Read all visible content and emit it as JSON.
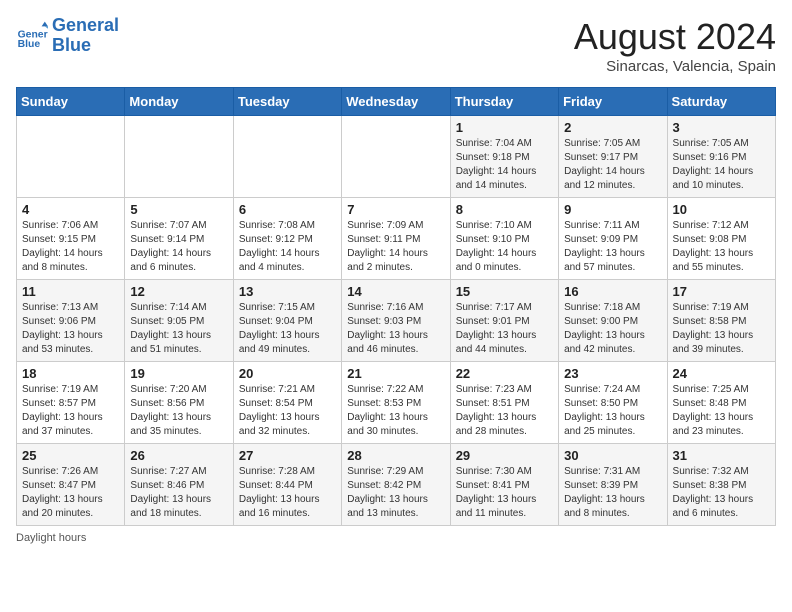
{
  "logo": {
    "line1": "General",
    "line2": "Blue"
  },
  "title": "August 2024",
  "location": "Sinarcas, Valencia, Spain",
  "days_of_week": [
    "Sunday",
    "Monday",
    "Tuesday",
    "Wednesday",
    "Thursday",
    "Friday",
    "Saturday"
  ],
  "weeks": [
    [
      {
        "day": "",
        "info": ""
      },
      {
        "day": "",
        "info": ""
      },
      {
        "day": "",
        "info": ""
      },
      {
        "day": "",
        "info": ""
      },
      {
        "day": "1",
        "info": "Sunrise: 7:04 AM\nSunset: 9:18 PM\nDaylight: 14 hours and 14 minutes."
      },
      {
        "day": "2",
        "info": "Sunrise: 7:05 AM\nSunset: 9:17 PM\nDaylight: 14 hours and 12 minutes."
      },
      {
        "day": "3",
        "info": "Sunrise: 7:05 AM\nSunset: 9:16 PM\nDaylight: 14 hours and 10 minutes."
      }
    ],
    [
      {
        "day": "4",
        "info": "Sunrise: 7:06 AM\nSunset: 9:15 PM\nDaylight: 14 hours and 8 minutes."
      },
      {
        "day": "5",
        "info": "Sunrise: 7:07 AM\nSunset: 9:14 PM\nDaylight: 14 hours and 6 minutes."
      },
      {
        "day": "6",
        "info": "Sunrise: 7:08 AM\nSunset: 9:12 PM\nDaylight: 14 hours and 4 minutes."
      },
      {
        "day": "7",
        "info": "Sunrise: 7:09 AM\nSunset: 9:11 PM\nDaylight: 14 hours and 2 minutes."
      },
      {
        "day": "8",
        "info": "Sunrise: 7:10 AM\nSunset: 9:10 PM\nDaylight: 14 hours and 0 minutes."
      },
      {
        "day": "9",
        "info": "Sunrise: 7:11 AM\nSunset: 9:09 PM\nDaylight: 13 hours and 57 minutes."
      },
      {
        "day": "10",
        "info": "Sunrise: 7:12 AM\nSunset: 9:08 PM\nDaylight: 13 hours and 55 minutes."
      }
    ],
    [
      {
        "day": "11",
        "info": "Sunrise: 7:13 AM\nSunset: 9:06 PM\nDaylight: 13 hours and 53 minutes."
      },
      {
        "day": "12",
        "info": "Sunrise: 7:14 AM\nSunset: 9:05 PM\nDaylight: 13 hours and 51 minutes."
      },
      {
        "day": "13",
        "info": "Sunrise: 7:15 AM\nSunset: 9:04 PM\nDaylight: 13 hours and 49 minutes."
      },
      {
        "day": "14",
        "info": "Sunrise: 7:16 AM\nSunset: 9:03 PM\nDaylight: 13 hours and 46 minutes."
      },
      {
        "day": "15",
        "info": "Sunrise: 7:17 AM\nSunset: 9:01 PM\nDaylight: 13 hours and 44 minutes."
      },
      {
        "day": "16",
        "info": "Sunrise: 7:18 AM\nSunset: 9:00 PM\nDaylight: 13 hours and 42 minutes."
      },
      {
        "day": "17",
        "info": "Sunrise: 7:19 AM\nSunset: 8:58 PM\nDaylight: 13 hours and 39 minutes."
      }
    ],
    [
      {
        "day": "18",
        "info": "Sunrise: 7:19 AM\nSunset: 8:57 PM\nDaylight: 13 hours and 37 minutes."
      },
      {
        "day": "19",
        "info": "Sunrise: 7:20 AM\nSunset: 8:56 PM\nDaylight: 13 hours and 35 minutes."
      },
      {
        "day": "20",
        "info": "Sunrise: 7:21 AM\nSunset: 8:54 PM\nDaylight: 13 hours and 32 minutes."
      },
      {
        "day": "21",
        "info": "Sunrise: 7:22 AM\nSunset: 8:53 PM\nDaylight: 13 hours and 30 minutes."
      },
      {
        "day": "22",
        "info": "Sunrise: 7:23 AM\nSunset: 8:51 PM\nDaylight: 13 hours and 28 minutes."
      },
      {
        "day": "23",
        "info": "Sunrise: 7:24 AM\nSunset: 8:50 PM\nDaylight: 13 hours and 25 minutes."
      },
      {
        "day": "24",
        "info": "Sunrise: 7:25 AM\nSunset: 8:48 PM\nDaylight: 13 hours and 23 minutes."
      }
    ],
    [
      {
        "day": "25",
        "info": "Sunrise: 7:26 AM\nSunset: 8:47 PM\nDaylight: 13 hours and 20 minutes."
      },
      {
        "day": "26",
        "info": "Sunrise: 7:27 AM\nSunset: 8:46 PM\nDaylight: 13 hours and 18 minutes."
      },
      {
        "day": "27",
        "info": "Sunrise: 7:28 AM\nSunset: 8:44 PM\nDaylight: 13 hours and 16 minutes."
      },
      {
        "day": "28",
        "info": "Sunrise: 7:29 AM\nSunset: 8:42 PM\nDaylight: 13 hours and 13 minutes."
      },
      {
        "day": "29",
        "info": "Sunrise: 7:30 AM\nSunset: 8:41 PM\nDaylight: 13 hours and 11 minutes."
      },
      {
        "day": "30",
        "info": "Sunrise: 7:31 AM\nSunset: 8:39 PM\nDaylight: 13 hours and 8 minutes."
      },
      {
        "day": "31",
        "info": "Sunrise: 7:32 AM\nSunset: 8:38 PM\nDaylight: 13 hours and 6 minutes."
      }
    ]
  ],
  "footer": "Daylight hours"
}
